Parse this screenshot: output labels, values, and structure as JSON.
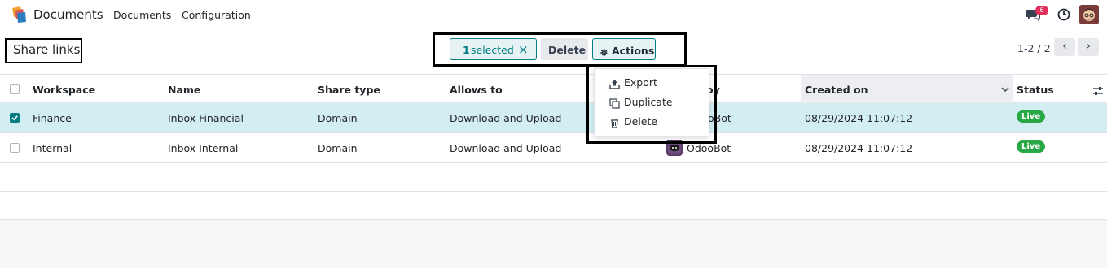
{
  "app": {
    "name": "Documents"
  },
  "menu": [
    {
      "label": "Documents"
    },
    {
      "label": "Configuration"
    }
  ],
  "systray": {
    "chat_count": "6"
  },
  "control": {
    "title": "Share links",
    "selected_count": "1",
    "selected_label": "selected",
    "delete_label": "Delete",
    "actions_label": "Actions",
    "pager": "1-2 / 2"
  },
  "actions_menu": [
    {
      "label": "Export",
      "icon": "upload-icon"
    },
    {
      "label": "Duplicate",
      "icon": "copy-icon"
    },
    {
      "label": "Delete",
      "icon": "trash-icon"
    }
  ],
  "table": {
    "columns": [
      "Workspace",
      "Name",
      "Share type",
      "Allows to",
      "oy",
      "Created on",
      "Status"
    ],
    "rows": [
      {
        "selected": true,
        "workspace": "Finance",
        "name": "Inbox Financial",
        "share_type": "Domain",
        "allows_to": "Download and Upload",
        "owner": "oBot",
        "created_on": "08/29/2024 11:07:12",
        "status": "Live"
      },
      {
        "selected": false,
        "workspace": "Internal",
        "name": "Inbox Internal",
        "share_type": "Domain",
        "allows_to": "Download and Upload",
        "owner": "OdooBot",
        "created_on": "08/29/2024 11:07:12",
        "status": "Live"
      }
    ]
  },
  "colors": {
    "accent": "#017e84",
    "status_live": "#28a745",
    "badge": "#e0315c",
    "row_selected": "#d3eef2"
  }
}
